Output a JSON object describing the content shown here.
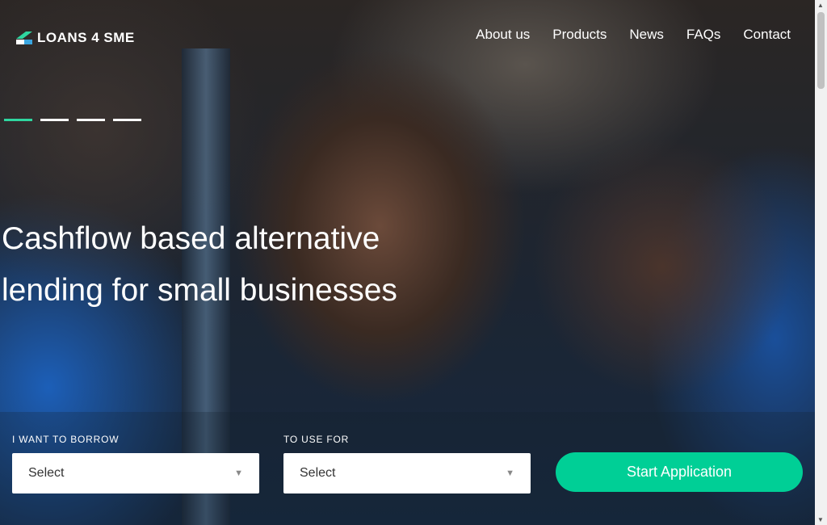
{
  "brand": {
    "name": "LOANS 4 SME"
  },
  "nav": [
    "About us",
    "Products",
    "News",
    "FAQs",
    "Contact"
  ],
  "hero": {
    "line1": "Cashflow based alternative",
    "line2": "lending for small businesses",
    "slides": 4,
    "active_slide": 1
  },
  "form": {
    "borrow": {
      "label": "I WANT TO BORROW",
      "value": "Select"
    },
    "use": {
      "label": "TO USE FOR",
      "value": "Select"
    },
    "submit": "Start Application"
  },
  "colors": {
    "accent": "#00cf96"
  }
}
